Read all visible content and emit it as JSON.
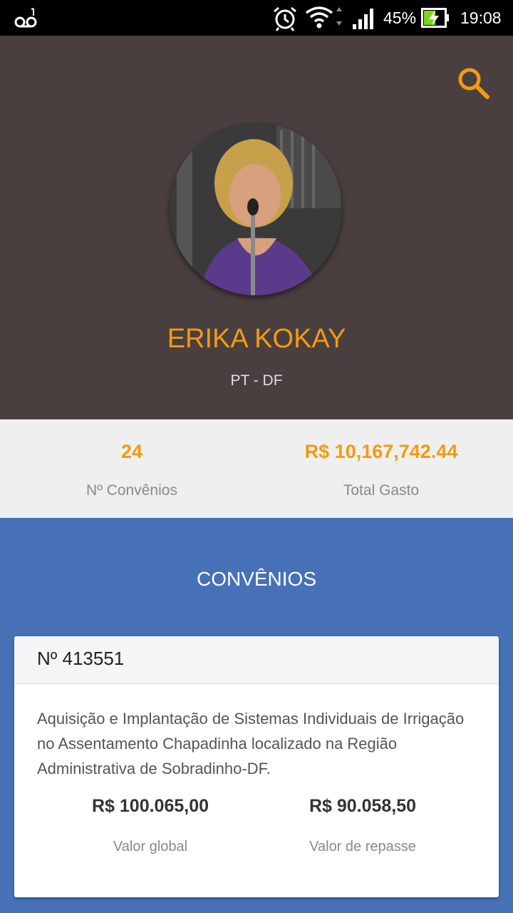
{
  "status_bar": {
    "battery_percent": "45%",
    "time": "19:08",
    "icons": [
      "voicemail-icon",
      "alarm-icon",
      "wifi-icon",
      "signal-icon",
      "battery-charging-icon"
    ]
  },
  "profile": {
    "name": "ERIKA KOKAY",
    "party": "PT - DF",
    "search_icon": "search-icon",
    "accent_color": "#f39a12",
    "header_bg": "#4a3f3f"
  },
  "stats": {
    "convenios_count": "24",
    "convenios_label": "Nº Convênios",
    "total_spent": "R$ 10,167,742.44",
    "total_spent_label": "Total Gasto"
  },
  "section": {
    "title": "CONVÊNIOS",
    "bg_color": "#4671b6"
  },
  "cards": [
    {
      "number": "Nº 413551",
      "description": "Aquisição e Implantação de Sistemas Individuais de Irrigação no Assentamento Chapadinha localizado na Região Administrativa de Sobradinho-DF.",
      "global_value": "R$ 100.065,00",
      "global_value_label": "Valor global",
      "transfer_value": "R$ 90.058,50",
      "transfer_value_label": "Valor de repasse"
    }
  ]
}
